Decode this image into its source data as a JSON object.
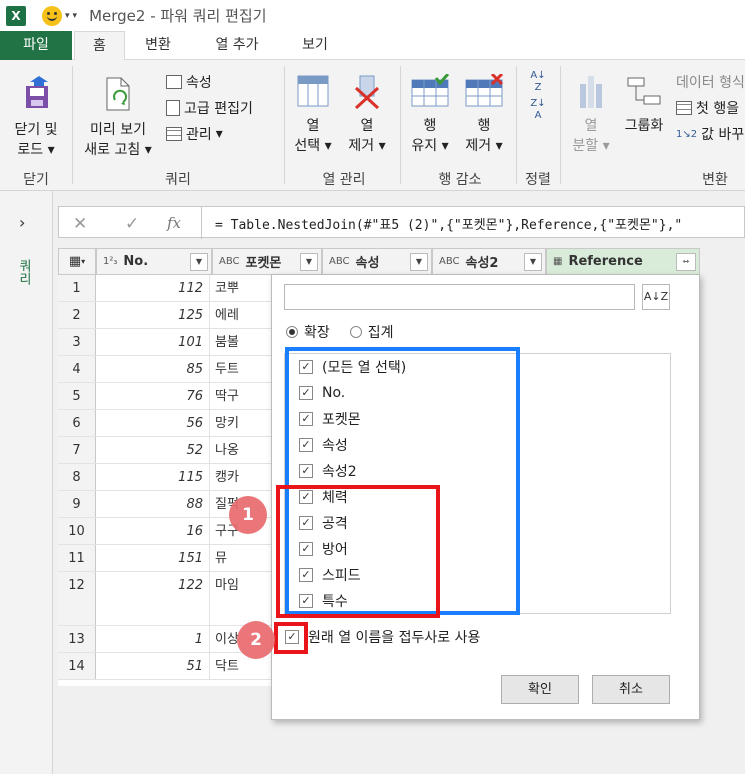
{
  "window": {
    "title": "Merge2 - 파워 쿼리 편집기"
  },
  "tabs": [
    "파일",
    "홈",
    "변환",
    "열 추가",
    "보기"
  ],
  "ribbon": {
    "close": {
      "line1": "닫기 및",
      "line2": "로드"
    },
    "preview": {
      "line1": "미리 보기",
      "line2": "새로 고침"
    },
    "properties": "속성",
    "advanced_editor": "고급 편집기",
    "manage": "관리",
    "select_columns": {
      "line1": "열",
      "line2": "선택"
    },
    "remove_columns": {
      "line1": "열",
      "line2": "제거"
    },
    "keep_rows": {
      "line1": "행",
      "line2": "유지"
    },
    "remove_rows": {
      "line1": "행",
      "line2": "제거"
    },
    "split_column": {
      "line1": "열",
      "line2": "분할"
    },
    "group_by": "그룹화",
    "data_type": "데이터 형식",
    "first_row": "첫 행을",
    "replace_values": "값 바꾸",
    "groups": [
      "닫기",
      "쿼리",
      "열 관리",
      "행 감소",
      "정렬",
      "변환"
    ]
  },
  "sidebar": {
    "label": "쿼리"
  },
  "formula": {
    "text": "= Table.NestedJoin(#\"표5 (2)\",{\"포켓몬\"},Reference,{\"포켓몬\"},\""
  },
  "columns": [
    {
      "type": "1²₃",
      "name": "No."
    },
    {
      "type": "ABC",
      "name": "포켓몬"
    },
    {
      "type": "ABC",
      "name": "속성"
    },
    {
      "type": "ABC",
      "name": "속성2"
    },
    {
      "type": "table",
      "name": "Reference"
    }
  ],
  "rows": [
    {
      "n": "1",
      "no": "112",
      "name": "코뿌"
    },
    {
      "n": "2",
      "no": "125",
      "name": "에레"
    },
    {
      "n": "3",
      "no": "101",
      "name": "붐볼"
    },
    {
      "n": "4",
      "no": "85",
      "name": "두트"
    },
    {
      "n": "5",
      "no": "76",
      "name": "딱구"
    },
    {
      "n": "6",
      "no": "56",
      "name": "망키"
    },
    {
      "n": "7",
      "no": "52",
      "name": "나옹"
    },
    {
      "n": "8",
      "no": "115",
      "name": "캥카"
    },
    {
      "n": "9",
      "no": "88",
      "name": "질퍽"
    },
    {
      "n": "10",
      "no": "16",
      "name": "구구"
    },
    {
      "n": "11",
      "no": "151",
      "name": "뮤"
    },
    {
      "n": "12",
      "no": "122",
      "name": "마임"
    },
    {
      "n": "13",
      "no": "1",
      "name": "이상"
    },
    {
      "n": "14",
      "no": "51",
      "name": "닥트"
    }
  ],
  "dialog": {
    "search_placeholder": "",
    "expand_label": "확장",
    "aggregate_label": "집계",
    "columns": [
      "(모든 열 선택)",
      "No.",
      "포켓몬",
      "속성",
      "속성2",
      "체력",
      "공격",
      "방어",
      "스피드",
      "특수"
    ],
    "prefix_label": "원래 열 이름을 접두사로 사용",
    "ok": "확인",
    "cancel": "취소"
  },
  "annotations": {
    "badge1": "1",
    "badge2": "2"
  }
}
